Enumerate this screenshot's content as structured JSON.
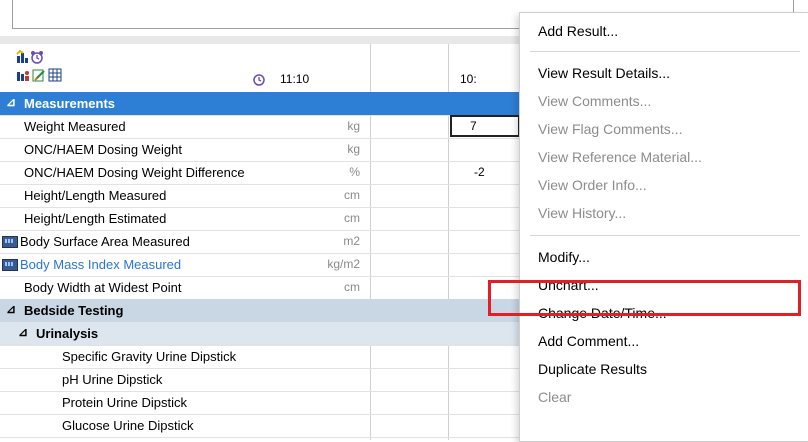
{
  "colors": {
    "accent": "#2d7fd6",
    "highlight": "#e21f26"
  },
  "icons": [
    "chart-bars-icon",
    "alarm-clock-icon",
    "chart-person-icon",
    "edit-icon",
    "grid-icon",
    "timer-icon"
  ],
  "grid": {
    "time_col_1": "11:10",
    "time_col_2": "10:",
    "rows": [
      {
        "type": "group",
        "label": "Measurements"
      },
      {
        "label": "Weight Measured",
        "unit": "kg",
        "value": "7"
      },
      {
        "label": "ONC/HAEM Dosing Weight",
        "unit": "kg",
        "value": ""
      },
      {
        "label": "ONC/HAEM Dosing Weight Difference",
        "unit": "%",
        "value": "-2"
      },
      {
        "label": "Height/Length Measured",
        "unit": "cm",
        "value": ""
      },
      {
        "label": "Height/Length Estimated",
        "unit": "cm",
        "value": ""
      },
      {
        "label": "Body Surface Area Measured",
        "unit": "m2",
        "value": ""
      },
      {
        "label": "Body Mass Index Measured",
        "unit": "kg/m2",
        "value": ""
      },
      {
        "label": "Body Width at Widest Point",
        "unit": "cm",
        "value": ""
      },
      {
        "type": "group",
        "label": "Bedside Testing"
      },
      {
        "type": "subgroup",
        "label": "Urinalysis"
      },
      {
        "label": "Specific Gravity Urine Dipstick"
      },
      {
        "label": "pH Urine Dipstick"
      },
      {
        "label": "Protein Urine Dipstick"
      },
      {
        "label": "Glucose Urine Dipstick"
      }
    ]
  },
  "menu": {
    "add_result": "Add Result...",
    "view_result_details": "View Result Details...",
    "view_comments": "View Comments...",
    "view_flag_comments": "View Flag Comments...",
    "view_reference_material": "View Reference Material...",
    "view_order_info": "View Order Info...",
    "view_history": "View History...",
    "modify": "Modify...",
    "unchart": "Unchart...",
    "change_date_time": "Change Date/Time...",
    "add_comment": "Add Comment...",
    "duplicate_results": "Duplicate Results",
    "clear": "Clear"
  }
}
